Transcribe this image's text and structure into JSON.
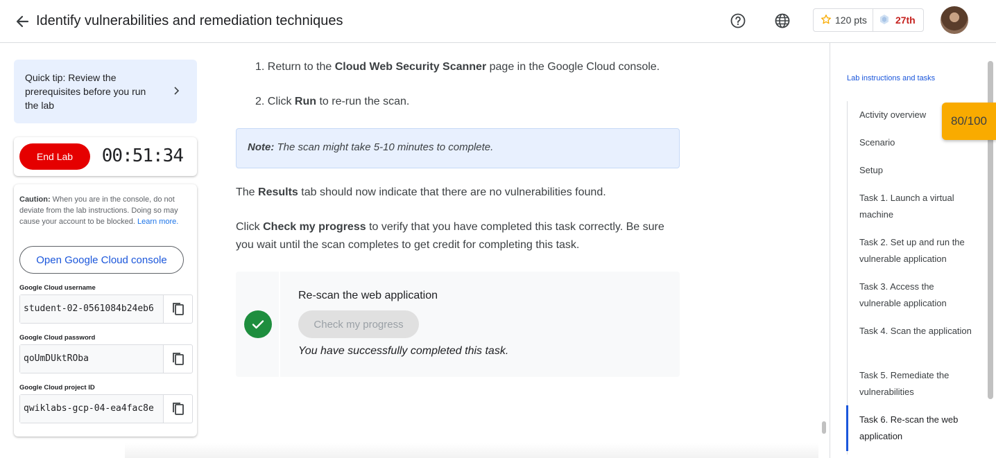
{
  "header": {
    "title": "Identify vulnerabilities and remediation techniques",
    "points": "120 pts",
    "rank": "27th"
  },
  "left_panel": {
    "tip": "Quick tip: Review the prerequisites before you run the lab",
    "end_lab_label": "End Lab",
    "timer": "00:51:34",
    "caution_label": "Caution:",
    "caution_text": " When you are in the console, do not deviate from the lab instructions. Doing so may cause your account to be blocked. ",
    "learn_more": "Learn more.",
    "console_button": "Open Google Cloud console",
    "fields": [
      {
        "label": "Google Cloud username",
        "value": "student-02-0561084b24eb6"
      },
      {
        "label": "Google Cloud password",
        "value": "qoUmDUktROba"
      },
      {
        "label": "Google Cloud project ID",
        "value": "qwiklabs-gcp-04-ea4fac8e"
      }
    ]
  },
  "content": {
    "step1_num": "1.",
    "step1_pre": "Return to the ",
    "step1_bold": "Cloud Web Security Scanner",
    "step1_post": " page in the Google Cloud console.",
    "step2_num": "2.",
    "step2_pre": "Click ",
    "step2_bold": "Run",
    "step2_post": " to re-run the scan.",
    "note_label": "Note:",
    "note_text": " The scan might take 5-10 minutes to complete.",
    "results_pre": "The ",
    "results_bold": "Results",
    "results_post": " tab should now indicate that there are no vulnerabilities found.",
    "click_pre": "Click ",
    "click_bold": "Check my progress",
    "click_post": " to verify that you have completed this task correctly. Be sure you wait until the scan completes to get credit for completing this task.",
    "check_title": "Re-scan the web application",
    "check_button": "Check my progress",
    "check_done": "You have successfully completed this task."
  },
  "toc": {
    "title": "Lab instructions and tasks",
    "items": [
      "Activity overview",
      "Scenario",
      "Setup",
      "Task 1. Launch a virtual machine",
      "Task 2. Set up and run the vulnerable application",
      "Task 3. Access the vulnerable application",
      "Task 4. Scan the application",
      "Task 5. Remediate the vulnerabilities",
      "Task 6. Re-scan the web application"
    ],
    "active_index": 8,
    "score": "80/100"
  },
  "colors": {
    "accent": "#1a56db",
    "end_lab": "#e50000",
    "success": "#1e8e3e",
    "score_badge": "#f9ab00",
    "rank": "#c5221f"
  },
  "icons": [
    "back-arrow-icon",
    "help-icon",
    "globe-icon",
    "star-icon",
    "league-icon",
    "chevron-right-icon",
    "copy-icon",
    "check-icon"
  ]
}
